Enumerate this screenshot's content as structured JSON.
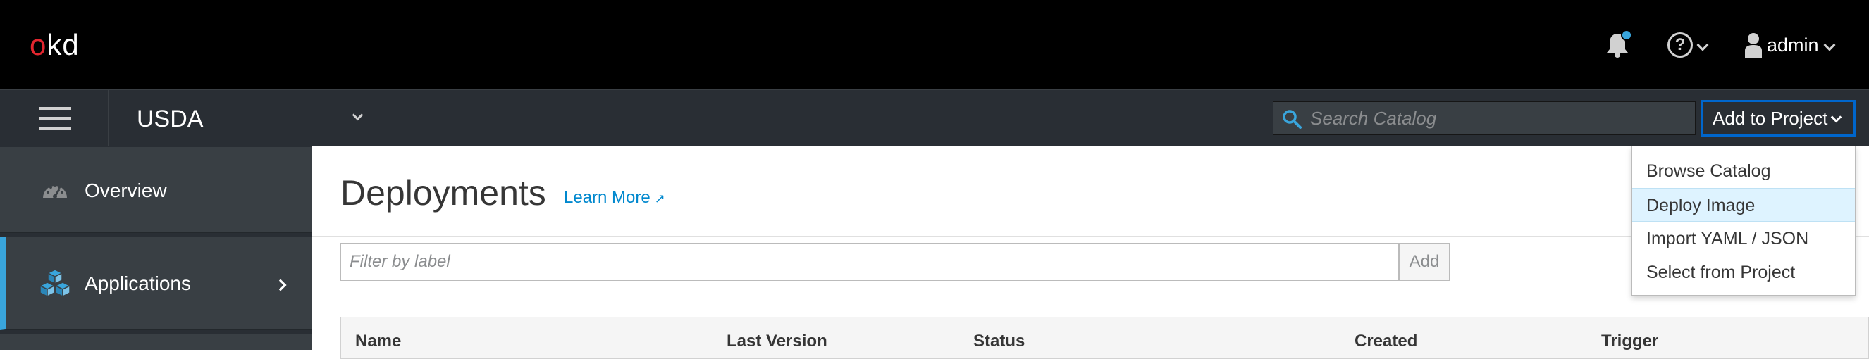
{
  "masthead": {
    "logo_prefix": "o",
    "logo_suffix": "kd",
    "user_name": "admin"
  },
  "project_bar": {
    "project_name": "USDA",
    "search_placeholder": "Search Catalog",
    "add_to_project_label": "Add to Project"
  },
  "sidebar": {
    "items": [
      {
        "label": "Overview",
        "icon": "dashboard-icon"
      },
      {
        "label": "Applications",
        "icon": "cubes-icon"
      }
    ]
  },
  "main": {
    "title": "Deployments",
    "learn_more": "Learn More",
    "filter_placeholder": "Filter by label",
    "filter_add_label": "Add",
    "columns": [
      "Name",
      "Last Version",
      "Status",
      "Created",
      "Trigger"
    ]
  },
  "dropdown": {
    "items": [
      {
        "label": "Browse Catalog",
        "active": false
      },
      {
        "label": "Deploy Image",
        "active": true
      },
      {
        "label": "Import YAML / JSON",
        "active": false
      },
      {
        "label": "Select from Project",
        "active": false
      }
    ]
  },
  "colors": {
    "masthead_bg": "#000000",
    "bar_bg": "#292e34",
    "accent": "#0066cc",
    "link": "#0088ce",
    "logo_red": "#e3262f",
    "highlight": "#def3ff"
  }
}
